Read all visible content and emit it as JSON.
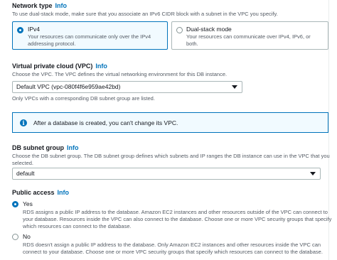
{
  "network_type": {
    "label": "Network type",
    "info": "Info",
    "description": "To use dual-stack mode, make sure that you associate an IPv6 CIDR block with a subnet in the VPC you specify.",
    "options": [
      {
        "title": "IPv4",
        "description_line1": "Your resources can communicate only over the IPv4",
        "description_line2": "addressing protocol.",
        "selected": true
      },
      {
        "title": "Dual-stack mode",
        "description_line1": "Your resources can communicate over IPv4, IPv6, or",
        "description_line2": "both.",
        "selected": false
      }
    ]
  },
  "vpc": {
    "label": "Virtual private cloud (VPC)",
    "info": "Info",
    "description": "Choose the VPC. The VPC defines the virtual networking environment for this DB instance.",
    "selected_value": "Default VPC (vpc-080f4f6e959ae42bd)",
    "hint": "Only VPCs with a corresponding DB subnet group are listed."
  },
  "alert": {
    "icon": "info-circle-icon",
    "text": "After a database is created, you can't change its VPC."
  },
  "subnet_group": {
    "label": "DB subnet group",
    "info": "Info",
    "description_line1": "Choose the DB subnet group. The DB subnet group defines which subnets and IP ranges the DB instance can use in the VPC that you",
    "description_line2": "selected.",
    "selected_value": "default"
  },
  "public_access": {
    "label": "Public access",
    "info": "Info",
    "options": [
      {
        "title": "Yes",
        "selected": true,
        "description_lines": [
          "RDS assigns a public IP address to the database. Amazon EC2 instances and other resources outside of the VPC can connect to",
          "your database. Resources inside the VPC can also connect to the database. Choose one or more VPC security groups that specify",
          "which resources can connect to the database."
        ]
      },
      {
        "title": "No",
        "selected": false,
        "description_lines": [
          "RDS doesn't assign a public IP address to the database. Only Amazon EC2 instances and other resources inside the VPC can",
          "connect to your database. Choose one or more VPC security groups that specify which resources can connect to the database."
        ]
      }
    ]
  },
  "colors": {
    "accent": "#0073bb",
    "text": "#16191f",
    "muted": "#545b64",
    "border": "#aab7b8",
    "selected_bg": "#f1faff"
  }
}
